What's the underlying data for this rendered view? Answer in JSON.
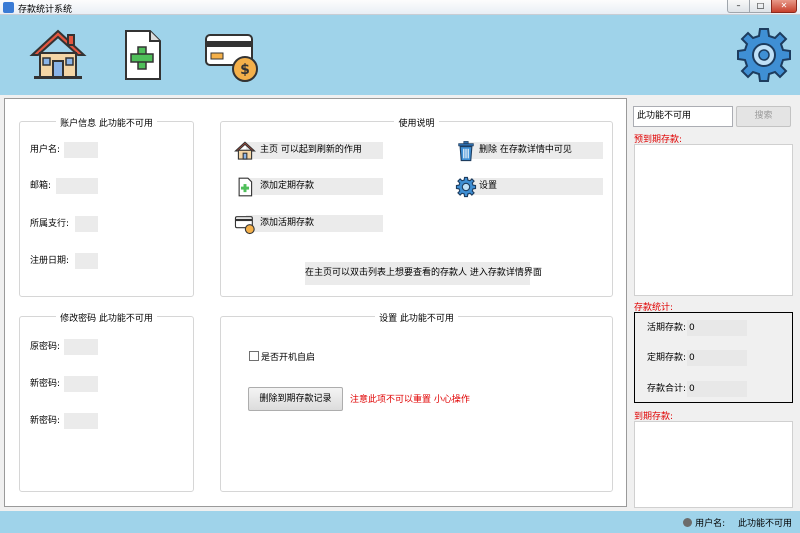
{
  "window": {
    "title": "存款统计系统",
    "min": "–",
    "max": "□",
    "close": "✕"
  },
  "toolbar": {
    "home_icon": "house-icon",
    "add_fixed_icon": "document-plus-icon",
    "add_current_icon": "card-dollar-icon",
    "settings_icon": "gear-icon"
  },
  "account": {
    "title": "账户信息 此功能不可用",
    "fields": [
      {
        "label": "用户名:",
        "value": ""
      },
      {
        "label": "邮箱:",
        "value": ""
      },
      {
        "label": "所属支行:",
        "value": ""
      },
      {
        "label": "注册日期:",
        "value": ""
      }
    ]
  },
  "usage": {
    "title": "使用说明",
    "items": [
      {
        "text": "主页 可以起到刷新的作用",
        "icon": "house-icon"
      },
      {
        "text": "删除 在存款详情中可见",
        "icon": "trash-icon"
      },
      {
        "text": "添加定期存款",
        "icon": "document-plus-icon"
      },
      {
        "text": "设置",
        "icon": "gear-icon"
      },
      {
        "text": "添加活期存款",
        "icon": "card-dollar-icon"
      }
    ],
    "note": "在主页可以双击列表上想要查看的存款人 进入存款详情界面"
  },
  "password": {
    "title": "修改密码 此功能不可用",
    "fields": [
      {
        "label": "原密码:",
        "value": ""
      },
      {
        "label": "新密码:",
        "value": ""
      },
      {
        "label": "新密码:",
        "value": ""
      }
    ]
  },
  "settings": {
    "title": "设置 此功能不可用",
    "autostart_label": "是否开机自启",
    "autostart_checked": false,
    "delete_button": "删除到期存款记录",
    "warning": "注意此项不可以重置 小心操作",
    "warning_color": "#e00000"
  },
  "sidebar": {
    "search_value": "此功能不可用",
    "search_button": "搜索",
    "expiring_label": "预到期存款:",
    "stats_label": "存款统计:",
    "stats": [
      {
        "label": "活期存款:",
        "value": "0"
      },
      {
        "label": "定期存款:",
        "value": "0"
      },
      {
        "label": "存款合计:",
        "value": "0"
      }
    ],
    "expired_label": "到期存款:"
  },
  "status": {
    "user_label": "用户名:",
    "user_value": "此功能不可用"
  },
  "colors": {
    "toolbar_bg": "#9fd3ea",
    "accent_red": "#e00000"
  }
}
